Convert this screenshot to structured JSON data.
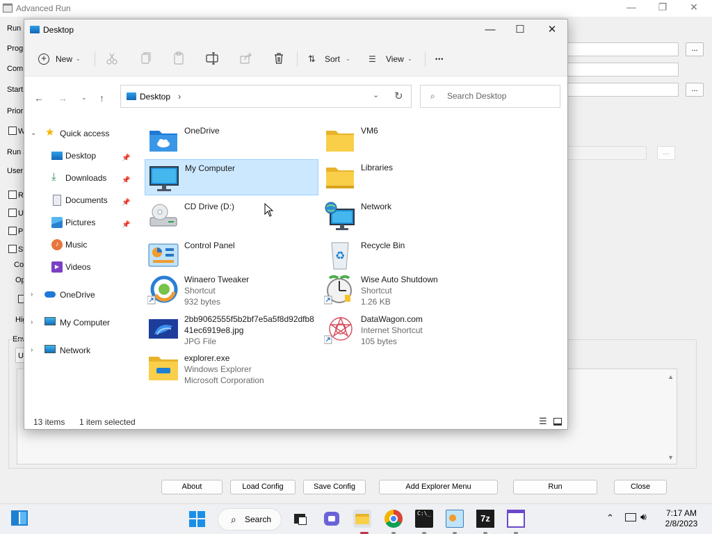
{
  "background_app": {
    "title": "Advanced Run",
    "labels": {
      "run": "Run I",
      "program": "Progr",
      "command": "Comm",
      "start": "Start",
      "priority": "Priori",
      "run_as": "Run a",
      "user": "User",
      "env_label": "Env",
      "co": "Co",
      "op": "Op",
      "hig": "Hig",
      "u": "U"
    },
    "check_labels": [
      "W",
      "R",
      "U",
      "P",
      "St"
    ],
    "dots_label": "...",
    "buttons": {
      "about": "About",
      "load_config": "Load Config",
      "save_config": "Save Config",
      "add_explorer_menu": "Add Explorer Menu",
      "run": "Run",
      "close": "Close"
    }
  },
  "explorer": {
    "title": "Desktop",
    "toolbar": {
      "new": "New",
      "sort": "Sort",
      "view": "View",
      "more": "•••"
    },
    "address": {
      "path": "Desktop",
      "separator": "›"
    },
    "search": {
      "placeholder": "Search Desktop"
    },
    "nav": {
      "quick_access": "Quick access",
      "pinned": [
        {
          "label": "Desktop",
          "icon": "desktop-icon"
        },
        {
          "label": "Downloads",
          "icon": "downloads-icon"
        },
        {
          "label": "Documents",
          "icon": "documents-icon"
        },
        {
          "label": "Pictures",
          "icon": "pictures-icon"
        }
      ],
      "unpinned": [
        {
          "label": "Music",
          "icon": "music-icon"
        },
        {
          "label": "Videos",
          "icon": "videos-icon"
        }
      ],
      "roots": [
        {
          "label": "OneDrive",
          "icon": "cloud-icon"
        },
        {
          "label": "My Computer",
          "icon": "computer-icon"
        },
        {
          "label": "Network",
          "icon": "network-icon"
        }
      ]
    },
    "items": [
      {
        "name": "OneDrive",
        "icon": "onedrive-folder-icon"
      },
      {
        "name": "VM6",
        "icon": "folder-icon"
      },
      {
        "name": "My Computer",
        "icon": "computer-icon",
        "selected": true
      },
      {
        "name": "Libraries",
        "icon": "libraries-icon"
      },
      {
        "name": "CD Drive (D:)",
        "icon": "cd-drive-icon"
      },
      {
        "name": "Network",
        "icon": "network-icon"
      },
      {
        "name": "Control Panel",
        "icon": "control-panel-icon"
      },
      {
        "name": "Recycle Bin",
        "icon": "recycle-bin-icon"
      },
      {
        "name": "Winaero Tweaker",
        "line2": "Shortcut",
        "line3": "932 bytes",
        "icon": "winaero-tweaker-icon"
      },
      {
        "name": "Wise Auto Shutdown",
        "line2": "Shortcut",
        "line3": "1.26 KB",
        "icon": "wise-auto-shutdown-icon"
      },
      {
        "name": "2bb9062555f5b2bf7e5a5f8d92dfb841ec6919e8.jpg",
        "line2": "JPG File",
        "icon": "image-file-icon"
      },
      {
        "name": "DataWagon.com",
        "line2": "Internet Shortcut",
        "line3": "105 bytes",
        "icon": "internet-shortcut-icon"
      },
      {
        "name": "explorer.exe",
        "line2": "Windows Explorer",
        "line3": "Microsoft Corporation",
        "icon": "explorer-exe-icon"
      }
    ],
    "status": {
      "count": "13 items",
      "selection": "1 item selected"
    }
  },
  "taskbar": {
    "search_label": "Search",
    "time": "7:17 AM",
    "date": "2/8/2023"
  },
  "colors": {
    "selection_bg": "#cce8ff",
    "selection_border": "#99d1ff",
    "folder": "#f5c542",
    "accent": "#0078d4"
  }
}
